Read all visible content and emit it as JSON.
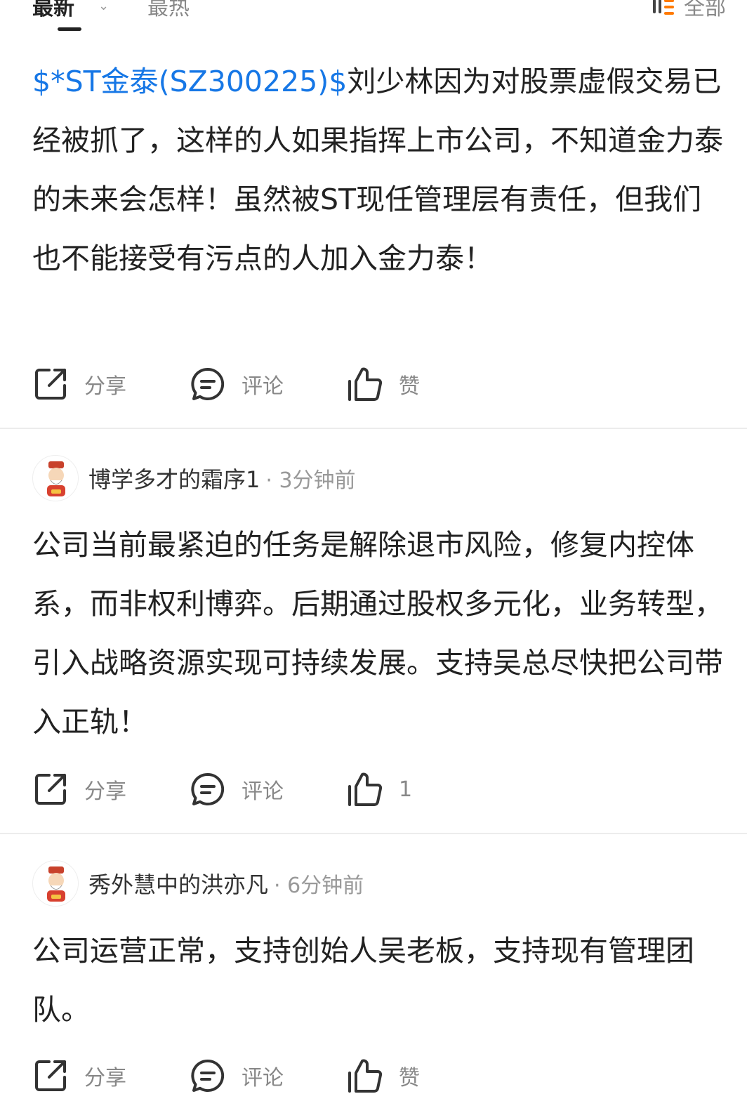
{
  "tabs": {
    "latest": "最新",
    "hot": "最热",
    "filter_label": "全部"
  },
  "posts": [
    {
      "stock_link": "$*ST金泰(SZ300225)$",
      "text": "刘少林因为对股票虚假交易已经被抓了，这样的人如果指挥上市公司，不知道金力泰的未来会怎样！虽然被ST现任管理层有责任，但我们也不能接受有污点的人加入金力泰！",
      "share_label": "分享",
      "comment_label": "评论",
      "like_label": "赞"
    },
    {
      "author": "博学多才的霜序1",
      "time": "· 3分钟前",
      "text": "公司当前最紧迫的任务是解除退市风险，修复内控体系，而非权利博弈。后期通过股权多元化，业务转型，引入战略资源实现可持续发展。支持吴总尽快把公司带入正轨！",
      "share_label": "分享",
      "comment_label": "评论",
      "like_label": "1"
    },
    {
      "author": "秀外慧中的洪亦凡",
      "time": "· 6分钟前",
      "text": "公司运营正常，支持创始人吴老板，支持现有管理团队。",
      "share_label": "分享",
      "comment_label": "评论",
      "like_label": "赞"
    }
  ],
  "icons": {
    "share": "share-icon",
    "comment": "comment-icon",
    "like": "thumbs-up-icon",
    "filter": "filter-icon",
    "avatar": "caishen-avatar"
  },
  "colors": {
    "link": "#1677e6",
    "text": "#222222",
    "muted": "#888888"
  }
}
